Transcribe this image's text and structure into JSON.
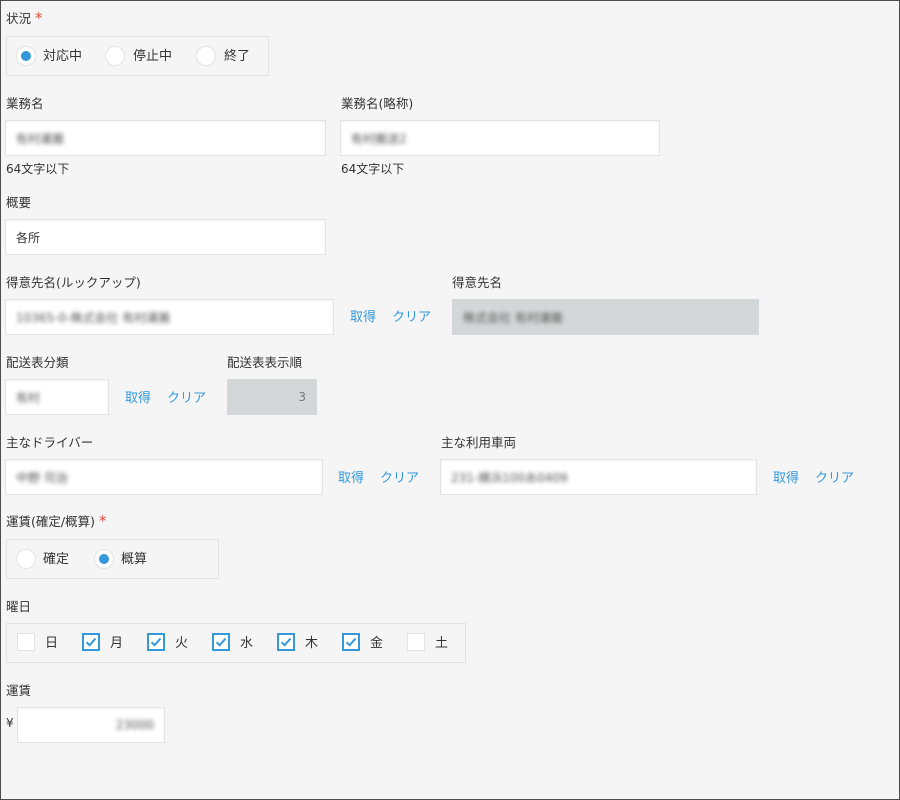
{
  "status": {
    "label": "状況",
    "required": "*",
    "options": [
      "対応中",
      "停止中",
      "終了"
    ],
    "selected": 0
  },
  "business_name": {
    "label": "業務名",
    "value": "有村運搬",
    "hint": "64文字以下"
  },
  "business_short": {
    "label": "業務名(略称)",
    "value": "有村搬送2",
    "hint": "64文字以下"
  },
  "summary": {
    "label": "概要",
    "value": "各所"
  },
  "customer_lookup": {
    "label": "得意先名(ルックアップ)",
    "value": "10365-0-株式会社 有村運搬",
    "get": "取得",
    "clear": "クリア"
  },
  "customer_name": {
    "label": "得意先名",
    "value": "株式会社 有村運搬"
  },
  "delivery_category": {
    "label": "配送表分類",
    "value": "有村",
    "get": "取得",
    "clear": "クリア"
  },
  "delivery_order": {
    "label": "配送表表示順",
    "value": "3"
  },
  "driver": {
    "label": "主なドライバー",
    "value": "中野 司治",
    "get": "取得",
    "clear": "クリア"
  },
  "vehicle": {
    "label": "主な利用車両",
    "value": "231-横浜100あ0409",
    "get": "取得",
    "clear": "クリア"
  },
  "fare_type": {
    "label": "運賃(確定/概算)",
    "required": "*",
    "options": [
      "確定",
      "概算"
    ],
    "selected": 1
  },
  "weekday": {
    "label": "曜日",
    "days": [
      {
        "label": "日",
        "checked": false
      },
      {
        "label": "月",
        "checked": true
      },
      {
        "label": "火",
        "checked": true
      },
      {
        "label": "水",
        "checked": true
      },
      {
        "label": "木",
        "checked": true
      },
      {
        "label": "金",
        "checked": true
      },
      {
        "label": "土",
        "checked": false
      }
    ]
  },
  "fare": {
    "label": "運賃",
    "currency": "¥",
    "value": "23000"
  },
  "colors": {
    "accent": "#3498db",
    "required": "#e74c3c",
    "background": "#f5f5f5",
    "disabled": "#d4d7d7"
  }
}
